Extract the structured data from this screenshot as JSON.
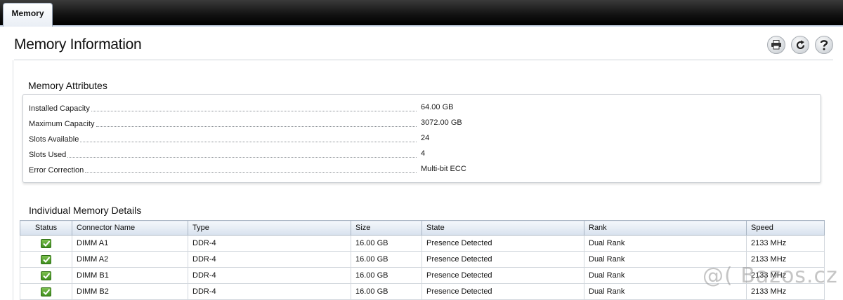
{
  "tabs": [
    {
      "label": "Memory"
    }
  ],
  "page": {
    "title": "Memory Information"
  },
  "toolbar": {
    "print_icon": "printer-icon",
    "refresh_icon": "refresh-icon",
    "help_icon": "help-icon"
  },
  "attributes": {
    "title": "Memory Attributes",
    "rows": [
      {
        "label": "Installed Capacity",
        "value": "64.00 GB"
      },
      {
        "label": "Maximum Capacity",
        "value": "3072.00 GB"
      },
      {
        "label": "Slots Available",
        "value": "24"
      },
      {
        "label": "Slots Used",
        "value": "4"
      },
      {
        "label": "Error Correction",
        "value": "Multi-bit ECC"
      }
    ]
  },
  "details": {
    "title": "Individual Memory Details",
    "columns": [
      "Status",
      "Connector Name",
      "Type",
      "Size",
      "State",
      "Rank",
      "Speed"
    ],
    "rows": [
      {
        "connector": "DIMM A1",
        "type": "DDR-4",
        "size": "16.00 GB",
        "state": "Presence Detected",
        "rank": "Dual Rank",
        "speed": "2133 MHz"
      },
      {
        "connector": "DIMM A2",
        "type": "DDR-4",
        "size": "16.00 GB",
        "state": "Presence Detected",
        "rank": "Dual Rank",
        "speed": "2133 MHz"
      },
      {
        "connector": "DIMM B1",
        "type": "DDR-4",
        "size": "16.00 GB",
        "state": "Presence Detected",
        "rank": "Dual Rank",
        "speed": "2133 MHz"
      },
      {
        "connector": "DIMM B2",
        "type": "DDR-4",
        "size": "16.00 GB",
        "state": "Presence Detected",
        "rank": "Dual Rank",
        "speed": "2133 MHz"
      }
    ]
  },
  "colors": {
    "status_ok": "#4ea62a",
    "header_bar": "#111111"
  },
  "watermark": {
    "text": "@( Bazos.cz"
  }
}
